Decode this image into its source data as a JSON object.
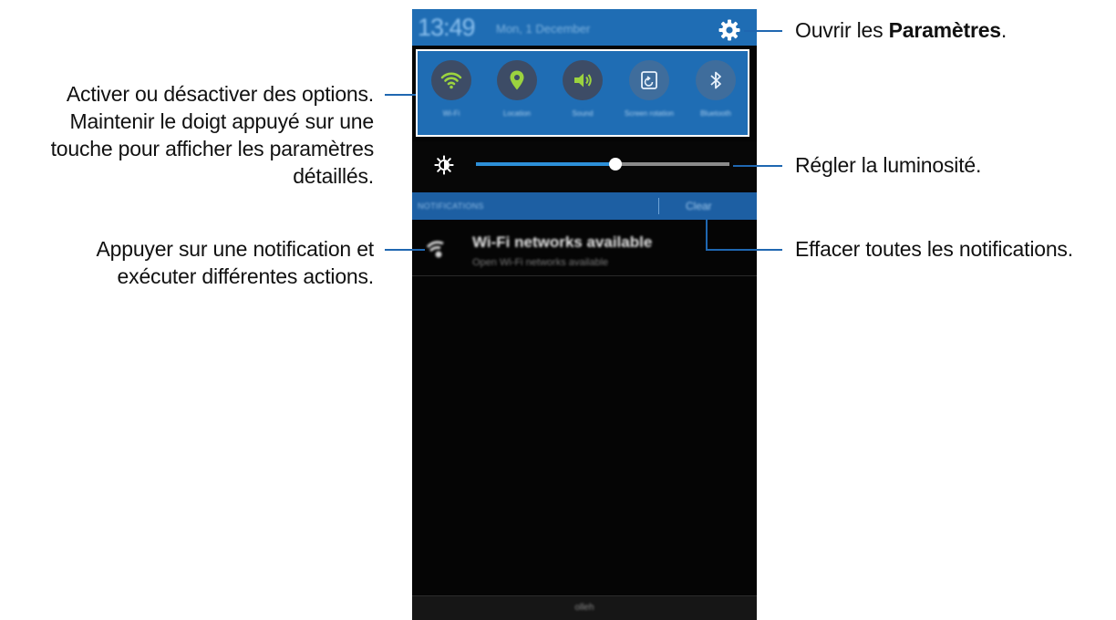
{
  "phone": {
    "status_bar": {
      "time": "13:49",
      "date": "Mon, 1 December",
      "settings_icon": "gear-icon"
    },
    "quick_settings": [
      {
        "id": "wifi",
        "label": "Wi-Fi",
        "icon": "wifi-icon",
        "state": "on"
      },
      {
        "id": "location",
        "label": "Location",
        "icon": "location-pin-icon",
        "state": "on"
      },
      {
        "id": "sound",
        "label": "Sound",
        "icon": "speaker-icon",
        "state": "on"
      },
      {
        "id": "rotation",
        "label": "Screen rotation",
        "icon": "screen-rotation-icon",
        "state": "off"
      },
      {
        "id": "bluetooth",
        "label": "Bluetooth",
        "icon": "bluetooth-icon",
        "state": "off"
      }
    ],
    "brightness": {
      "icon": "brightness-icon",
      "level": 0.55
    },
    "notifications": {
      "header": "NOTIFICATIONS",
      "clear_label": "Clear",
      "items": [
        {
          "title": "Wi-Fi networks available",
          "subtitle": "Open Wi-Fi networks available",
          "icon": "wifi-notification-icon"
        }
      ]
    },
    "carrier": "olleh"
  },
  "callouts": {
    "settings_prefix": "Ouvrir les ",
    "settings_bold": "Paramètres",
    "settings_suffix": ".",
    "options_line1": "Activer ou désactiver des options.",
    "options_line2": "Maintenir le doigt appuyé sur une",
    "options_line3": "touche pour afficher les paramètres",
    "options_line4": "détaillés.",
    "brightness": "Régler la luminosité.",
    "notif_line1": "Appuyer sur une notification et",
    "notif_line2": "exécuter différentes actions.",
    "clear": "Effacer toutes les notifications."
  },
  "colors": {
    "accent_blue": "#1f6db4",
    "callout_line": "#1f67b1",
    "toggle_on_icon": "#9bd33f"
  }
}
